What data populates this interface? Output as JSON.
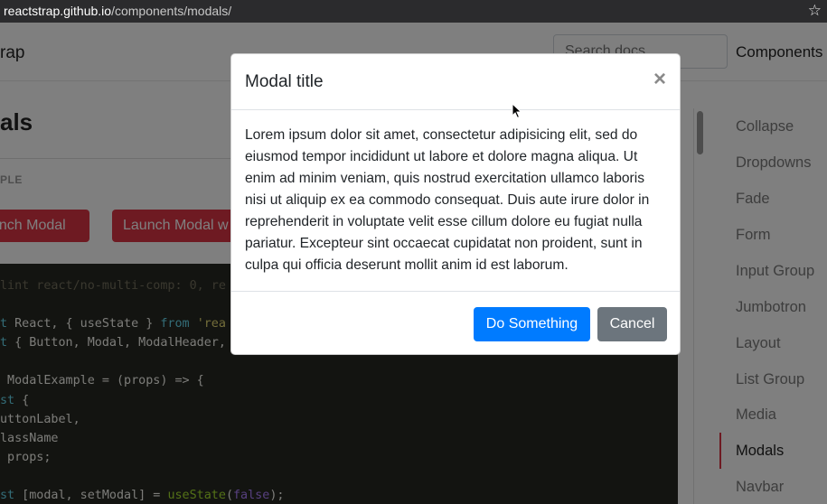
{
  "browser": {
    "url_host": "reactstrap.github.io",
    "url_path": "/components/modals/",
    "star_icon": "star-icon"
  },
  "navbar": {
    "brand": "rap",
    "search_placeholder": "Search docs",
    "components_link": "Components"
  },
  "main": {
    "page_title": "als",
    "section_label": "PLE",
    "launch_button_1": "unch Modal",
    "launch_button_2": "Launch Modal w"
  },
  "code_lines": [
    "lint react/no-multi-comp: 0, re",
    "",
    "t React, { useState } from 'rea",
    "t { Button, Modal, ModalHeader,",
    "",
    " ModalExample = (props) => {",
    "st {",
    "uttonLabel,",
    "lassName",
    " props;",
    "",
    "st [modal, setModal] = useState(false);"
  ],
  "sidebar": {
    "items": [
      "Collapse",
      "Dropdowns",
      "Fade",
      "Form",
      "Input Group",
      "Jumbotron",
      "Layout",
      "List Group",
      "Media",
      "Modals",
      "Navbar"
    ],
    "active": "Modals"
  },
  "modal": {
    "title": "Modal title",
    "close_glyph": "×",
    "body": "Lorem ipsum dolor sit amet, consectetur adipisicing elit, sed do eiusmod tempor incididunt ut labore et dolore magna aliqua. Ut enim ad minim veniam, quis nostrud exercitation ullamco laboris nisi ut aliquip ex ea commodo consequat. Duis aute irure dolor in reprehenderit in voluptate velit esse cillum dolore eu fugiat nulla pariatur. Excepteur sint occaecat cupidatat non proident, sunt in culpa qui officia deserunt mollit anim id est laborum.",
    "primary_button": "Do Something",
    "cancel_button": "Cancel"
  },
  "colors": {
    "primary": "#007bff",
    "secondary": "#6c757d",
    "danger": "#dc3545"
  }
}
